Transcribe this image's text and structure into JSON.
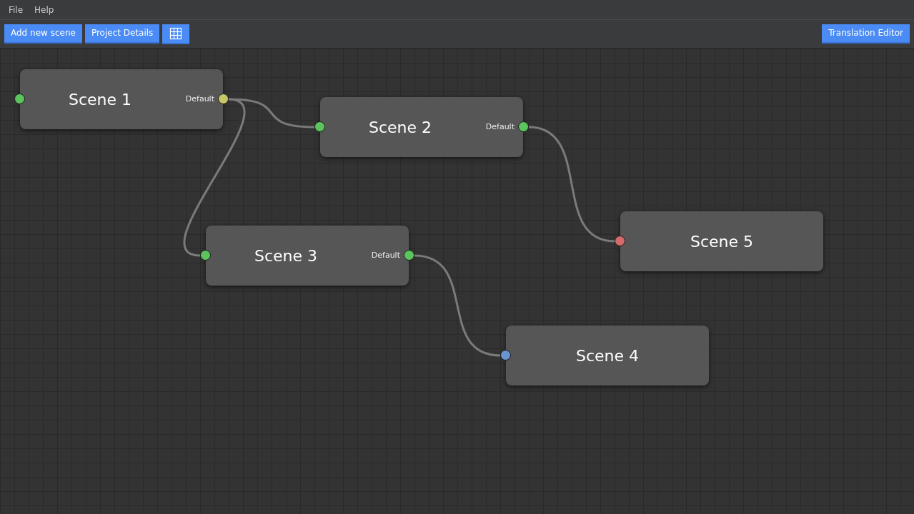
{
  "menu": [
    "File",
    "Help"
  ],
  "toolbar": {
    "buttons": [
      {
        "kind": "text",
        "label": "Add new scene"
      },
      {
        "kind": "text",
        "label": "Project Details"
      },
      {
        "kind": "grid"
      }
    ],
    "right_button": "Translation Editor"
  },
  "nodes": [
    {
      "title": "Scene 1",
      "input": {
        "color": "#5cc45c"
      },
      "output": {
        "label": "Default",
        "color": "#c9c765"
      }
    },
    {
      "title": "Scene 2",
      "input": {
        "color": "#5cc45c"
      },
      "output": {
        "label": "Default",
        "color": "#5cc45c"
      }
    },
    {
      "title": "Scene 3",
      "input": {
        "color": "#5cc45c"
      },
      "output": {
        "label": "Default",
        "color": "#5cc45c"
      }
    },
    {
      "title": "Scene 5",
      "input": {
        "color": "#d46a6a"
      }
    },
    {
      "title": "Scene 4",
      "input": {
        "color": "#6a95d0"
      }
    }
  ]
}
